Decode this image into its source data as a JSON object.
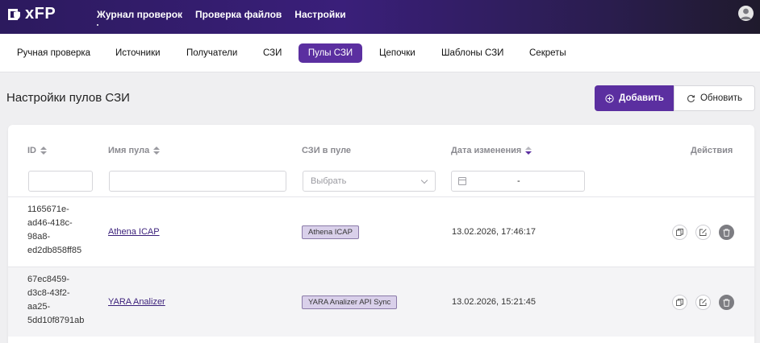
{
  "app": {
    "logo_text": "xFP"
  },
  "topnav": [
    {
      "label": "Журнал проверок"
    },
    {
      "label": "Проверка файлов"
    },
    {
      "label": "Настройки"
    }
  ],
  "subnav": [
    {
      "label": "Ручная проверка"
    },
    {
      "label": "Источники"
    },
    {
      "label": "Получатели"
    },
    {
      "label": "СЗИ"
    },
    {
      "label": "Пулы СЗИ"
    },
    {
      "label": "Цепочки"
    },
    {
      "label": "Шаблоны СЗИ"
    },
    {
      "label": "Секреты"
    }
  ],
  "page": {
    "title": "Настройки пулов СЗИ",
    "add_label": "Добавить",
    "refresh_label": "Обновить"
  },
  "table": {
    "columns": {
      "id": "ID",
      "name": "Имя пула",
      "szi": "СЗИ в пуле",
      "date": "Дата изменения",
      "actions": "Действия"
    },
    "filters": {
      "select_placeholder": "Выбрать",
      "date_separator": "-"
    },
    "rows": [
      {
        "id_lines": [
          "1165671e-",
          "ad46-418c-",
          "98a8-",
          "ed2db858ff85"
        ],
        "name": "Athena ICAP",
        "szi": "Athena ICAP",
        "date": "13.02.2026, 17:46:17"
      },
      {
        "id_lines": [
          "67ec8459-",
          "d3c8-43f2-",
          "aa25-",
          "5dd10f8791ab"
        ],
        "name": "YARA Analizer",
        "szi": "YARA Analizer API Sync",
        "date": "13.02.2026, 15:21:45"
      }
    ]
  },
  "colors": {
    "accent": "#5b2fa0",
    "topbar": "#2c1a5e"
  }
}
